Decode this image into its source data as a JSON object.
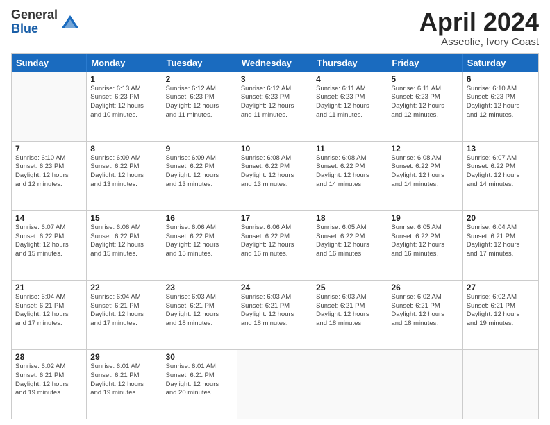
{
  "header": {
    "logo_general": "General",
    "logo_blue": "Blue",
    "title": "April 2024",
    "location": "Asseolie, Ivory Coast"
  },
  "days_of_week": [
    "Sunday",
    "Monday",
    "Tuesday",
    "Wednesday",
    "Thursday",
    "Friday",
    "Saturday"
  ],
  "weeks": [
    [
      {
        "num": "",
        "info": "",
        "empty": true
      },
      {
        "num": "1",
        "info": "Sunrise: 6:13 AM\nSunset: 6:23 PM\nDaylight: 12 hours\nand 10 minutes."
      },
      {
        "num": "2",
        "info": "Sunrise: 6:12 AM\nSunset: 6:23 PM\nDaylight: 12 hours\nand 11 minutes."
      },
      {
        "num": "3",
        "info": "Sunrise: 6:12 AM\nSunset: 6:23 PM\nDaylight: 12 hours\nand 11 minutes."
      },
      {
        "num": "4",
        "info": "Sunrise: 6:11 AM\nSunset: 6:23 PM\nDaylight: 12 hours\nand 11 minutes."
      },
      {
        "num": "5",
        "info": "Sunrise: 6:11 AM\nSunset: 6:23 PM\nDaylight: 12 hours\nand 12 minutes."
      },
      {
        "num": "6",
        "info": "Sunrise: 6:10 AM\nSunset: 6:23 PM\nDaylight: 12 hours\nand 12 minutes."
      }
    ],
    [
      {
        "num": "7",
        "info": "Sunrise: 6:10 AM\nSunset: 6:23 PM\nDaylight: 12 hours\nand 12 minutes."
      },
      {
        "num": "8",
        "info": "Sunrise: 6:09 AM\nSunset: 6:22 PM\nDaylight: 12 hours\nand 13 minutes."
      },
      {
        "num": "9",
        "info": "Sunrise: 6:09 AM\nSunset: 6:22 PM\nDaylight: 12 hours\nand 13 minutes."
      },
      {
        "num": "10",
        "info": "Sunrise: 6:08 AM\nSunset: 6:22 PM\nDaylight: 12 hours\nand 13 minutes."
      },
      {
        "num": "11",
        "info": "Sunrise: 6:08 AM\nSunset: 6:22 PM\nDaylight: 12 hours\nand 14 minutes."
      },
      {
        "num": "12",
        "info": "Sunrise: 6:08 AM\nSunset: 6:22 PM\nDaylight: 12 hours\nand 14 minutes."
      },
      {
        "num": "13",
        "info": "Sunrise: 6:07 AM\nSunset: 6:22 PM\nDaylight: 12 hours\nand 14 minutes."
      }
    ],
    [
      {
        "num": "14",
        "info": "Sunrise: 6:07 AM\nSunset: 6:22 PM\nDaylight: 12 hours\nand 15 minutes."
      },
      {
        "num": "15",
        "info": "Sunrise: 6:06 AM\nSunset: 6:22 PM\nDaylight: 12 hours\nand 15 minutes."
      },
      {
        "num": "16",
        "info": "Sunrise: 6:06 AM\nSunset: 6:22 PM\nDaylight: 12 hours\nand 15 minutes."
      },
      {
        "num": "17",
        "info": "Sunrise: 6:06 AM\nSunset: 6:22 PM\nDaylight: 12 hours\nand 16 minutes."
      },
      {
        "num": "18",
        "info": "Sunrise: 6:05 AM\nSunset: 6:22 PM\nDaylight: 12 hours\nand 16 minutes."
      },
      {
        "num": "19",
        "info": "Sunrise: 6:05 AM\nSunset: 6:22 PM\nDaylight: 12 hours\nand 16 minutes."
      },
      {
        "num": "20",
        "info": "Sunrise: 6:04 AM\nSunset: 6:21 PM\nDaylight: 12 hours\nand 17 minutes."
      }
    ],
    [
      {
        "num": "21",
        "info": "Sunrise: 6:04 AM\nSunset: 6:21 PM\nDaylight: 12 hours\nand 17 minutes."
      },
      {
        "num": "22",
        "info": "Sunrise: 6:04 AM\nSunset: 6:21 PM\nDaylight: 12 hours\nand 17 minutes."
      },
      {
        "num": "23",
        "info": "Sunrise: 6:03 AM\nSunset: 6:21 PM\nDaylight: 12 hours\nand 18 minutes."
      },
      {
        "num": "24",
        "info": "Sunrise: 6:03 AM\nSunset: 6:21 PM\nDaylight: 12 hours\nand 18 minutes."
      },
      {
        "num": "25",
        "info": "Sunrise: 6:03 AM\nSunset: 6:21 PM\nDaylight: 12 hours\nand 18 minutes."
      },
      {
        "num": "26",
        "info": "Sunrise: 6:02 AM\nSunset: 6:21 PM\nDaylight: 12 hours\nand 18 minutes."
      },
      {
        "num": "27",
        "info": "Sunrise: 6:02 AM\nSunset: 6:21 PM\nDaylight: 12 hours\nand 19 minutes."
      }
    ],
    [
      {
        "num": "28",
        "info": "Sunrise: 6:02 AM\nSunset: 6:21 PM\nDaylight: 12 hours\nand 19 minutes."
      },
      {
        "num": "29",
        "info": "Sunrise: 6:01 AM\nSunset: 6:21 PM\nDaylight: 12 hours\nand 19 minutes."
      },
      {
        "num": "30",
        "info": "Sunrise: 6:01 AM\nSunset: 6:21 PM\nDaylight: 12 hours\nand 20 minutes."
      },
      {
        "num": "",
        "info": "",
        "empty": true
      },
      {
        "num": "",
        "info": "",
        "empty": true
      },
      {
        "num": "",
        "info": "",
        "empty": true
      },
      {
        "num": "",
        "info": "",
        "empty": true
      }
    ]
  ]
}
